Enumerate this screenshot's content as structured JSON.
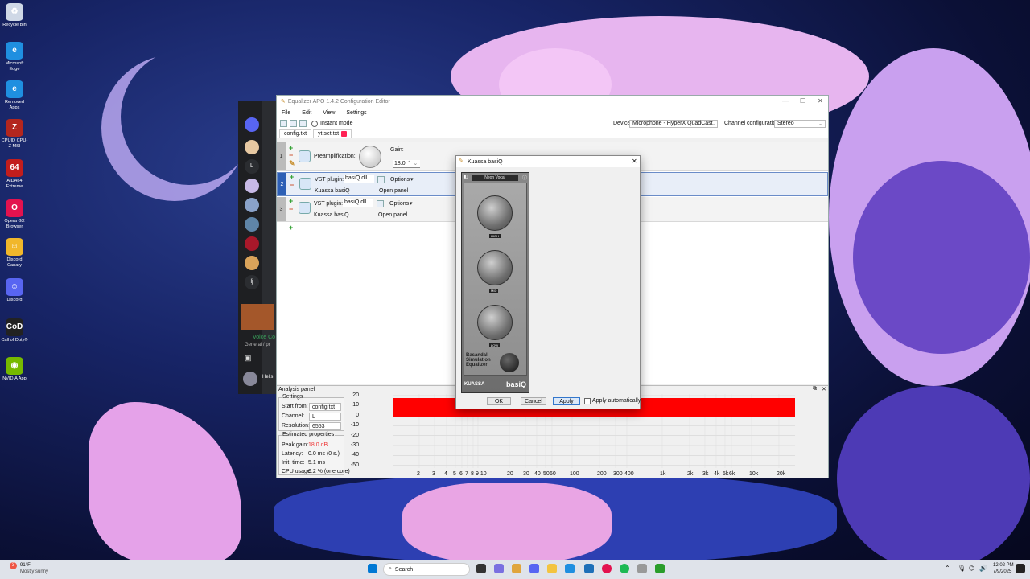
{
  "desktop": {
    "icons": [
      {
        "label": "Recycle Bin",
        "icon": "recycle-bin-icon",
        "color": "#cfd8e6",
        "glyph": "♻"
      },
      {
        "label": "Microsoft Edge",
        "icon": "edge-icon",
        "color": "#1f8fe0",
        "glyph": "e"
      },
      {
        "label": "Removed Apps",
        "icon": "edge-icon",
        "color": "#1f8fe0",
        "glyph": "e"
      },
      {
        "label": "CPUID CPU-Z MSI",
        "icon": "cpuz-icon",
        "color": "#b3261e",
        "glyph": "Z"
      },
      {
        "label": "AIDA64 Extreme",
        "icon": "aida64-icon",
        "color": "#c21d1d",
        "glyph": "64"
      },
      {
        "label": "Opera GX Browser",
        "icon": "opera-gx-icon",
        "color": "#e3124f",
        "glyph": "O"
      },
      {
        "label": "Discord Canary",
        "icon": "discord-canary-icon",
        "color": "#f1b72b",
        "glyph": "☺"
      },
      {
        "label": "Discord",
        "icon": "discord-icon",
        "color": "#5865f2",
        "glyph": "☺"
      },
      {
        "label": "Call of Duty®",
        "icon": "cod-icon",
        "color": "#222",
        "glyph": "CoD"
      },
      {
        "label": "NVIDIA App",
        "icon": "nvidia-icon",
        "color": "#76b900",
        "glyph": "◉"
      }
    ]
  },
  "discord": {
    "voice_connected": "Voice Co",
    "channel": "General / pr",
    "user": "Hells",
    "letter_l": "L",
    "letter_lj": "lj"
  },
  "editor": {
    "title": "Equalizer APO 1.4.2 Configuration Editor",
    "menu": [
      "File",
      "Edit",
      "View",
      "Settings"
    ],
    "instant_mode": "Instant mode",
    "device_label": "Device:",
    "device_value": "Microphone - HyperX QuadCast",
    "channel_config_label": "Channel configuration:",
    "channel_config_value": "Stereo",
    "tabs": [
      "config.txt",
      "yt set.txt"
    ],
    "rows": [
      {
        "num": "1",
        "type_label": "Preamplification:",
        "gain_label": "Gain:",
        "gain_value": "18.0"
      },
      {
        "num": "2",
        "type_label": "VST plugin:",
        "file": "basiQ.dll",
        "options": "Options",
        "name": "Kuassa basiQ",
        "open_panel": "Open panel"
      },
      {
        "num": "3",
        "type_label": "VST plugin:",
        "file": "basiQ.dll",
        "options": "Options",
        "name": "Kuassa basiQ",
        "open_panel": "Open panel"
      }
    ]
  },
  "analysis": {
    "title": "Analysis panel",
    "settings_title": "Settings",
    "start_from_label": "Start from:",
    "start_from_value": "config.txt",
    "channel_label": "Channel:",
    "channel_value": "L",
    "resolution_label": "Resolution:",
    "resolution_value": "6553",
    "est_title": "Estimated properties",
    "peak_gain_label": "Peak gain:",
    "peak_gain_value": "18.0 dB",
    "latency_label": "Latency:",
    "latency_value": "0.0 ms (0 s.)",
    "init_time_label": "Init. time:",
    "init_time_value": "5.1 ms",
    "cpu_label": "CPU usage:",
    "cpu_value": "0.2 % (one core)",
    "y_ticks": [
      "20",
      "10",
      "0",
      "-10",
      "-20",
      "-30",
      "-40",
      "-50"
    ],
    "x_ticks": [
      "2",
      "3",
      "4",
      "5",
      "6",
      "7",
      "8",
      "9 10",
      "20",
      "30",
      "40",
      "50",
      "60",
      "100",
      "200",
      "300",
      "400",
      "1k",
      "2k",
      "3k",
      "4k",
      "5k",
      "6k",
      "10k",
      "20k"
    ]
  },
  "dialog": {
    "title": "Kuassa basiQ",
    "preset": "Neon Vocal",
    "labels": [
      "HIGH",
      "MID",
      "LOW"
    ],
    "brand": "KUASSA",
    "product": "basiQ",
    "side_text": "Basandall Simulation Equalizer",
    "ok": "OK",
    "cancel": "Cancel",
    "apply": "Apply",
    "apply_auto": "Apply automatically"
  },
  "taskbar": {
    "temp": "91°F",
    "weather": "Mostly sunny",
    "search": "Search",
    "time": "12:02 PM",
    "date": "7/9/2025",
    "weather_badge": "3"
  }
}
